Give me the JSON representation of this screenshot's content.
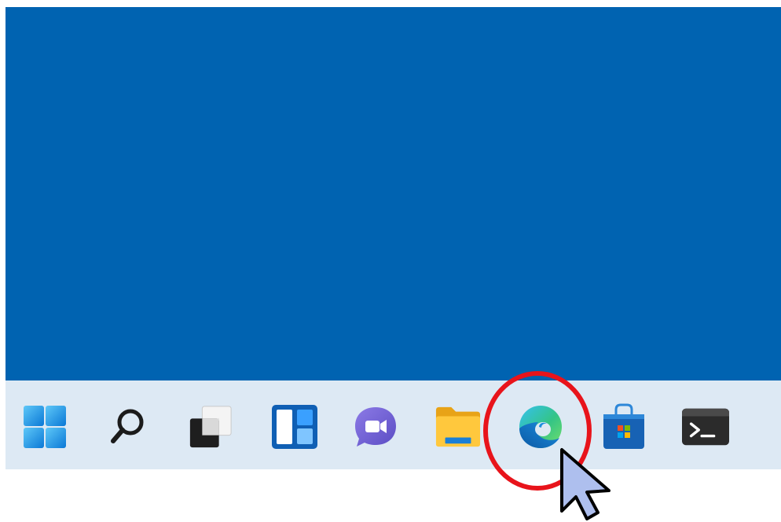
{
  "desktop": {
    "background_color": "#0063b1"
  },
  "taskbar": {
    "background_color": "#dde9f4",
    "items": [
      {
        "id": "start",
        "icon": "windows-start-icon"
      },
      {
        "id": "search",
        "icon": "search-icon"
      },
      {
        "id": "task-view",
        "icon": "task-view-icon"
      },
      {
        "id": "widgets",
        "icon": "widgets-icon"
      },
      {
        "id": "chat",
        "icon": "teams-chat-icon"
      },
      {
        "id": "file-explorer",
        "icon": "folder-icon"
      },
      {
        "id": "edge",
        "icon": "edge-browser-icon",
        "highlighted": true
      },
      {
        "id": "store",
        "icon": "microsoft-store-icon"
      },
      {
        "id": "terminal",
        "icon": "terminal-icon"
      }
    ]
  },
  "annotation": {
    "highlight_color": "#e8141b",
    "cursor": "mouse-pointer-icon"
  }
}
